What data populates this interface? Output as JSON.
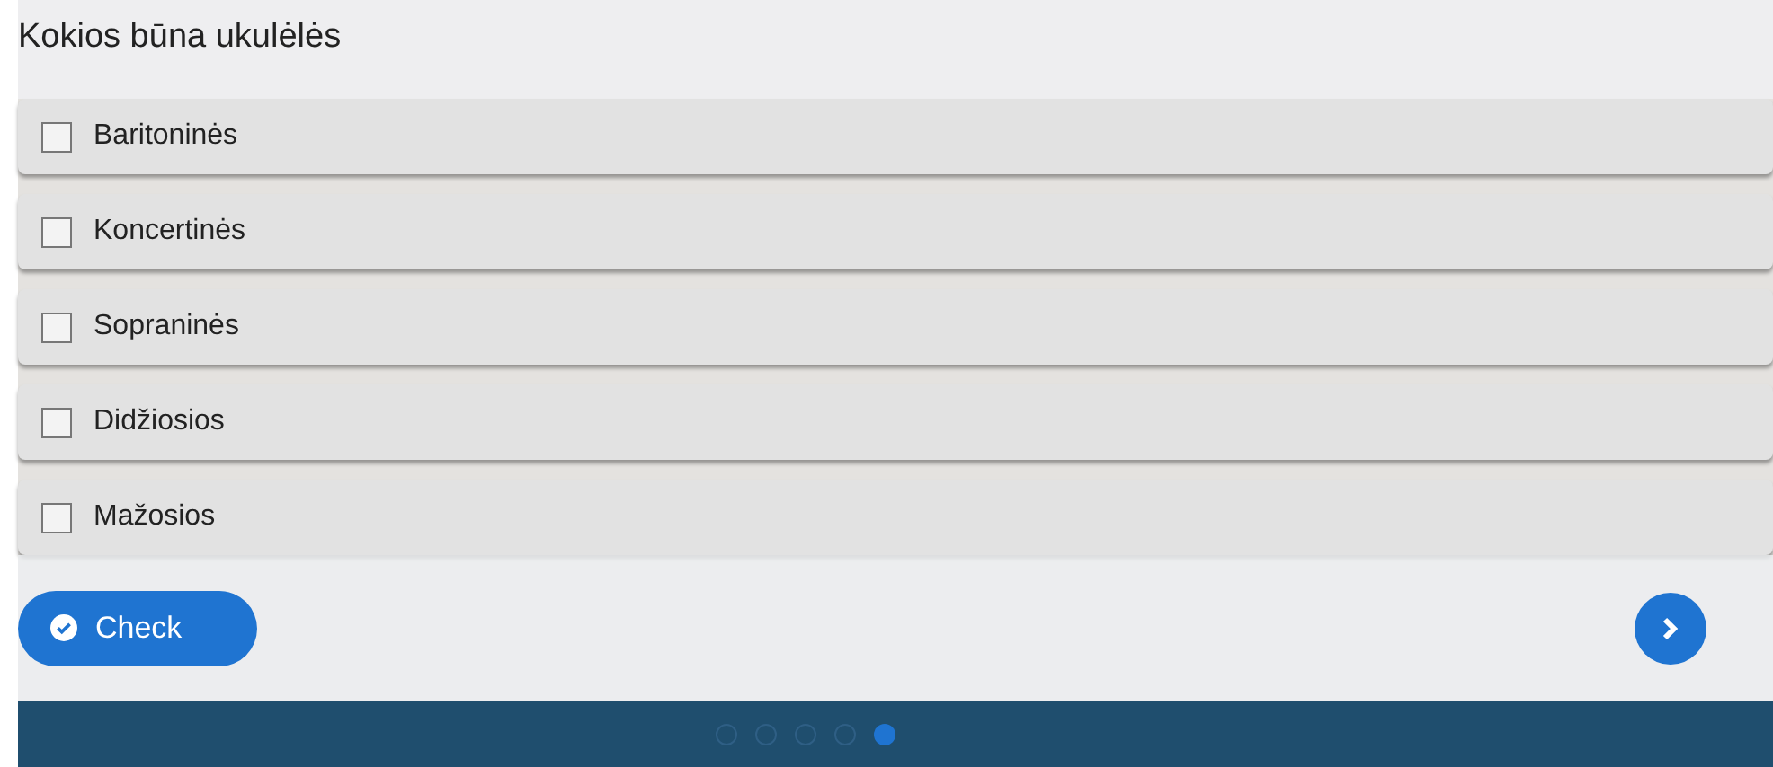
{
  "question": {
    "title": "Kokios būna ukulėlės"
  },
  "options": [
    {
      "label": "Baritoninės",
      "checked": false
    },
    {
      "label": "Koncertinės",
      "checked": false
    },
    {
      "label": "Sopraninės",
      "checked": false
    },
    {
      "label": "Didžiosios",
      "checked": false
    },
    {
      "label": "Mažosios",
      "checked": false
    }
  ],
  "check_button": {
    "label": "Check"
  },
  "slides": [
    {
      "selected": false
    },
    {
      "selected": false
    },
    {
      "selected": false
    },
    {
      "selected": false
    },
    {
      "selected": true
    }
  ]
}
